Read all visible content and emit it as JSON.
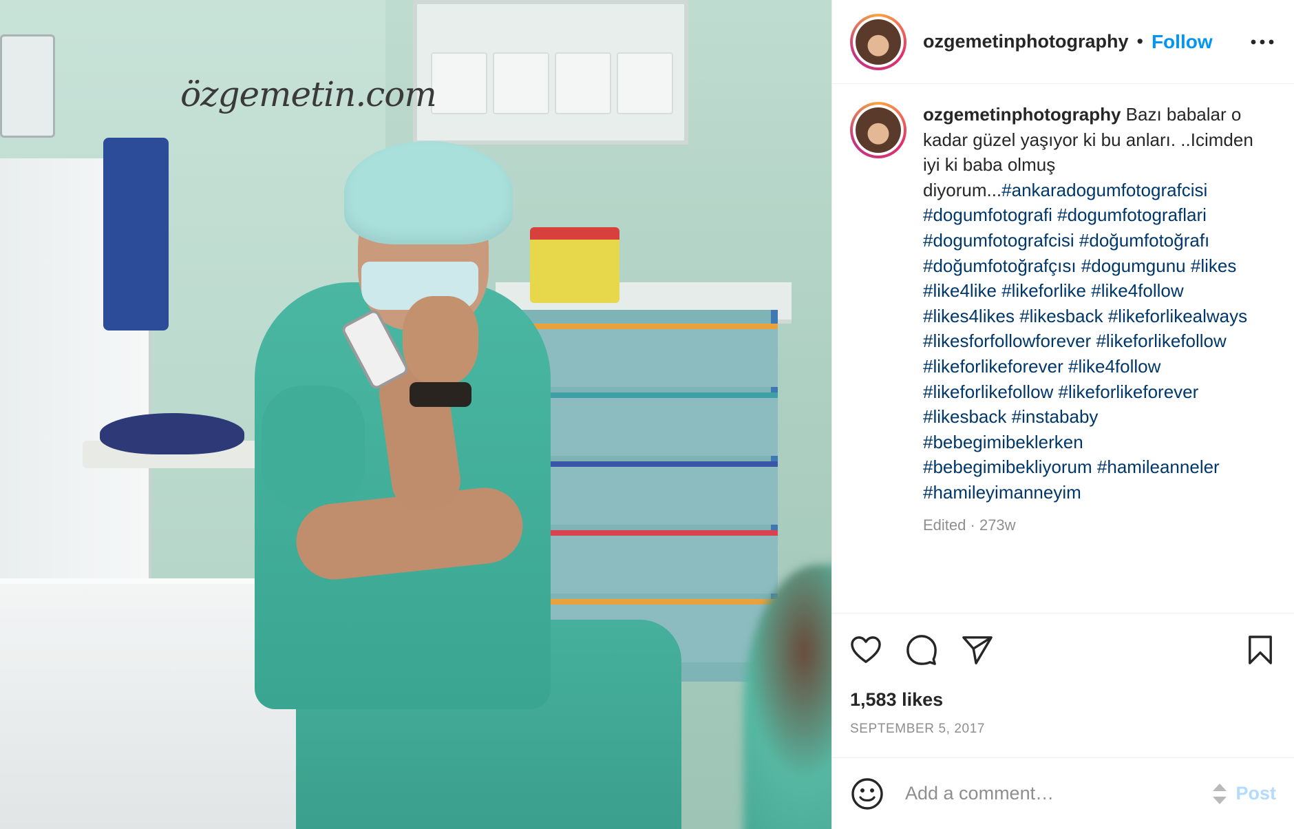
{
  "photo": {
    "watermark": "özgemetin.com",
    "alt_subject": "surgeon"
  },
  "header": {
    "username": "ozgemetinphotography",
    "separator": "•",
    "follow_label": "Follow",
    "more_icon": "more-horizontal-icon"
  },
  "caption": {
    "username": "ozgemetinphotography",
    "text_parts": [
      {
        "type": "text",
        "value": " Bazı babalar o kadar güzel yaşıyor ki bu anları. ..Icimden iyi ki baba olmuş diyorum..."
      },
      {
        "type": "tag",
        "value": "#ankaradogumfotografcisi"
      },
      {
        "type": "text",
        "value": " "
      },
      {
        "type": "tag",
        "value": "#dogumfotografi"
      },
      {
        "type": "text",
        "value": " "
      },
      {
        "type": "tag",
        "value": "#dogumfotograflari"
      },
      {
        "type": "text",
        "value": " "
      },
      {
        "type": "tag",
        "value": "#dogumfotografcisi"
      },
      {
        "type": "text",
        "value": " "
      },
      {
        "type": "tag",
        "value": "#doğumfotoğrafı"
      },
      {
        "type": "text",
        "value": " "
      },
      {
        "type": "tag",
        "value": "#doğumfotoğrafçısı"
      },
      {
        "type": "text",
        "value": " "
      },
      {
        "type": "tag",
        "value": "#dogumgunu"
      },
      {
        "type": "text",
        "value": " "
      },
      {
        "type": "tag",
        "value": "#likes"
      },
      {
        "type": "text",
        "value": " "
      },
      {
        "type": "tag",
        "value": "#like4like"
      },
      {
        "type": "text",
        "value": " "
      },
      {
        "type": "tag",
        "value": "#likeforlike"
      },
      {
        "type": "text",
        "value": " "
      },
      {
        "type": "tag",
        "value": "#like4follow"
      },
      {
        "type": "text",
        "value": " "
      },
      {
        "type": "tag",
        "value": "#likes4likes"
      },
      {
        "type": "text",
        "value": " "
      },
      {
        "type": "tag",
        "value": "#likesback"
      },
      {
        "type": "text",
        "value": " "
      },
      {
        "type": "tag",
        "value": "#likeforlikealways"
      },
      {
        "type": "text",
        "value": " "
      },
      {
        "type": "tag",
        "value": "#likesforfollowforever"
      },
      {
        "type": "text",
        "value": " "
      },
      {
        "type": "tag",
        "value": "#likeforlikefollow"
      },
      {
        "type": "text",
        "value": " "
      },
      {
        "type": "tag",
        "value": "#likeforlikeforever"
      },
      {
        "type": "text",
        "value": " "
      },
      {
        "type": "tag",
        "value": "#like4follow"
      },
      {
        "type": "text",
        "value": " "
      },
      {
        "type": "tag",
        "value": "#likeforlikefollow"
      },
      {
        "type": "text",
        "value": " "
      },
      {
        "type": "tag",
        "value": "#likeforlikeforever"
      },
      {
        "type": "text",
        "value": " "
      },
      {
        "type": "tag",
        "value": "#likesback"
      },
      {
        "type": "text",
        "value": " "
      },
      {
        "type": "tag",
        "value": "#instababy"
      },
      {
        "type": "text",
        "value": " "
      },
      {
        "type": "tag",
        "value": "#bebegimibeklerken"
      },
      {
        "type": "text",
        "value": " "
      },
      {
        "type": "tag",
        "value": "#bebegimibekliyorum"
      },
      {
        "type": "text",
        "value": " "
      },
      {
        "type": "tag",
        "value": "#hamileanneler"
      },
      {
        "type": "text",
        "value": " "
      },
      {
        "type": "tag",
        "value": "#hamileyimanneyim"
      }
    ],
    "edited_label": "Edited",
    "meta_separator": " · ",
    "age": "273w"
  },
  "actions": {
    "like_icon": "heart-icon",
    "comment_icon": "comment-icon",
    "share_icon": "send-icon",
    "save_icon": "bookmark-icon"
  },
  "likes_text": "1,583 likes",
  "date_text": "SEPTEMBER 5, 2017",
  "comment": {
    "emoji_icon": "emoji-icon",
    "placeholder": "Add a comment…",
    "post_label": "Post"
  },
  "colors": {
    "link_blue": "#0095f6",
    "hashtag": "#00376b",
    "muted": "#8e8e8e",
    "post_disabled": "#b3dbff"
  }
}
